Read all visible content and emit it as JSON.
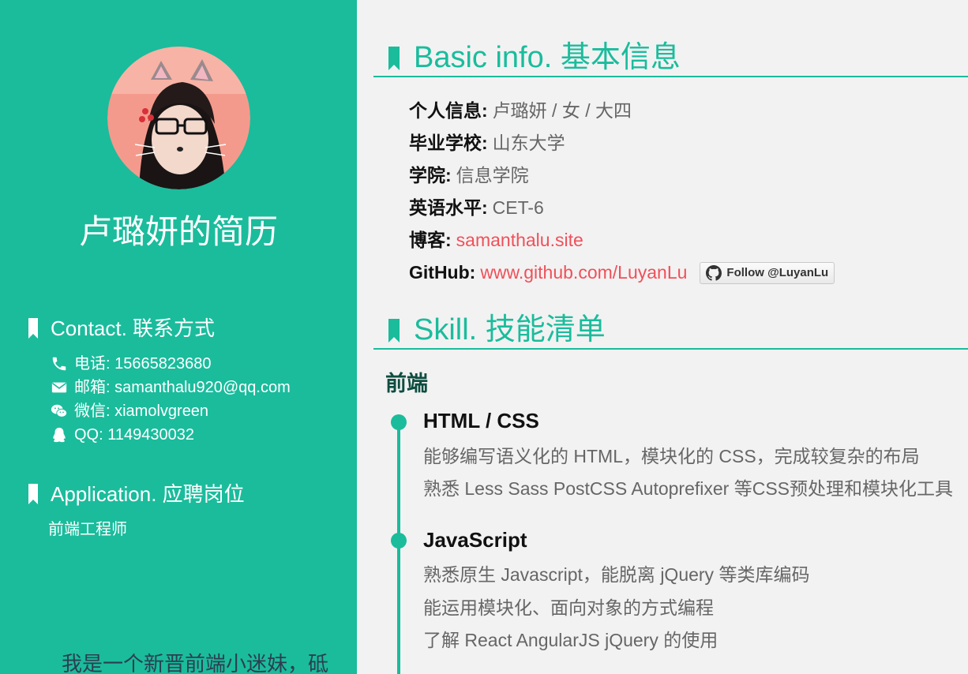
{
  "sidebar": {
    "name_title": "卢璐妍的简历",
    "contact": {
      "heading": "Contact. 联系方式",
      "items": [
        {
          "icon": "phone-icon",
          "text": "电话: 15665823680"
        },
        {
          "icon": "envelope-icon",
          "text": "邮箱: samanthalu920@qq.com"
        },
        {
          "icon": "wechat-icon",
          "text": "微信: xiamolvgreen"
        },
        {
          "icon": "qq-icon",
          "text": "QQ: 1149430032"
        }
      ]
    },
    "application": {
      "heading": "Application. 应聘岗位",
      "role": "前端工程师"
    },
    "intro": "我是一个新晋前端小迷妹，砥"
  },
  "basic_info": {
    "heading": "Basic info. 基本信息",
    "personal": {
      "label": "个人信息:",
      "value": "卢璐妍 / 女 / 大四"
    },
    "school": {
      "label": "毕业学校:",
      "value": "山东大学"
    },
    "college": {
      "label": "学院:",
      "value": "信息学院"
    },
    "english": {
      "label": "英语水平:",
      "value": "CET-6"
    },
    "blog": {
      "label": "博客:",
      "link": "samanthalu.site"
    },
    "github": {
      "label": "GitHub:",
      "link": "www.github.com/LuyanLu",
      "follow_button": "Follow @LuyanLu"
    }
  },
  "skills": {
    "heading": "Skill. 技能清单",
    "frontend_heading": "前端",
    "groups": [
      {
        "title": "HTML / CSS",
        "lines": [
          "能够编写语义化的 HTML，模块化的 CSS，完成较复杂的布局",
          "熟悉 Less Sass PostCSS Autoprefixer 等CSS预处理和模块化工具"
        ]
      },
      {
        "title": "JavaScript",
        "lines": [
          "熟悉原生 Javascript，能脱离 jQuery 等类库编码",
          "能运用模块化、面向对象的方式编程",
          "了解 React AngularJS jQuery 的使用"
        ]
      }
    ]
  },
  "colors": {
    "accent": "#1abc9c",
    "link": "#f0505a",
    "text_gray": "#666666"
  }
}
